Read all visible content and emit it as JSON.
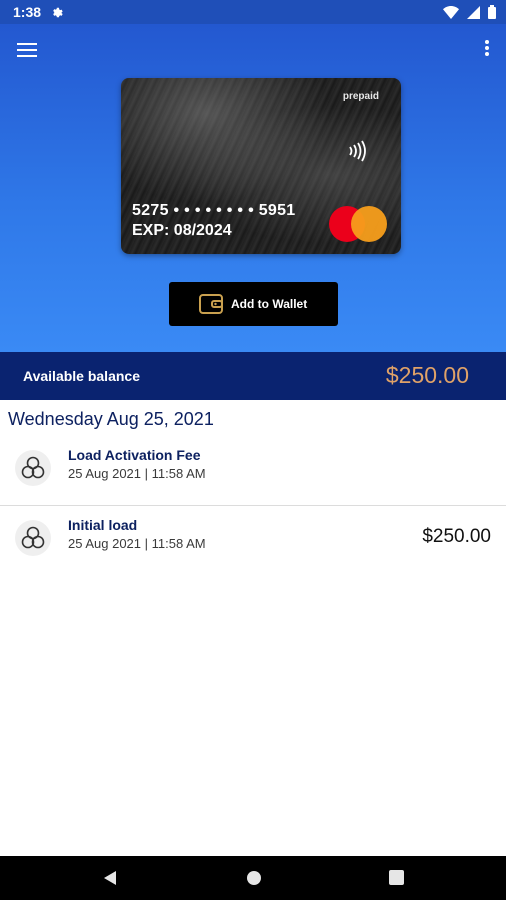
{
  "status_bar": {
    "time": "1:38",
    "icons": [
      "settings-icon",
      "wifi-icon",
      "signal-icon",
      "battery-icon"
    ]
  },
  "toolbar": {
    "menu_icon": "hamburger-menu-icon",
    "more_icon": "more-vertical-icon"
  },
  "card": {
    "badge": "prepaid",
    "number": "5275 • • • • • • • • 5951",
    "expiry": "EXP: 08/2024",
    "network": "mastercard",
    "contactless_icon": "contactless-icon"
  },
  "wallet_button": {
    "label": "Add to Wallet",
    "icon": "wallet-icon"
  },
  "balance": {
    "label": "Available balance",
    "amount": "$250.00",
    "amount_color": "#e0a268",
    "bar_color": "#0a2370"
  },
  "transactions": {
    "date_header": "Wednesday Aug 25, 2021",
    "items": [
      {
        "title": "Load Activation Fee",
        "timestamp": "25 Aug 2021 | 11:58 AM",
        "amount": ""
      },
      {
        "title": "Initial load",
        "timestamp": "25 Aug 2021 | 11:58 AM",
        "amount": "$250.00"
      }
    ]
  },
  "nav_bar": {
    "buttons": [
      "back-icon",
      "home-icon",
      "recents-icon"
    ]
  }
}
